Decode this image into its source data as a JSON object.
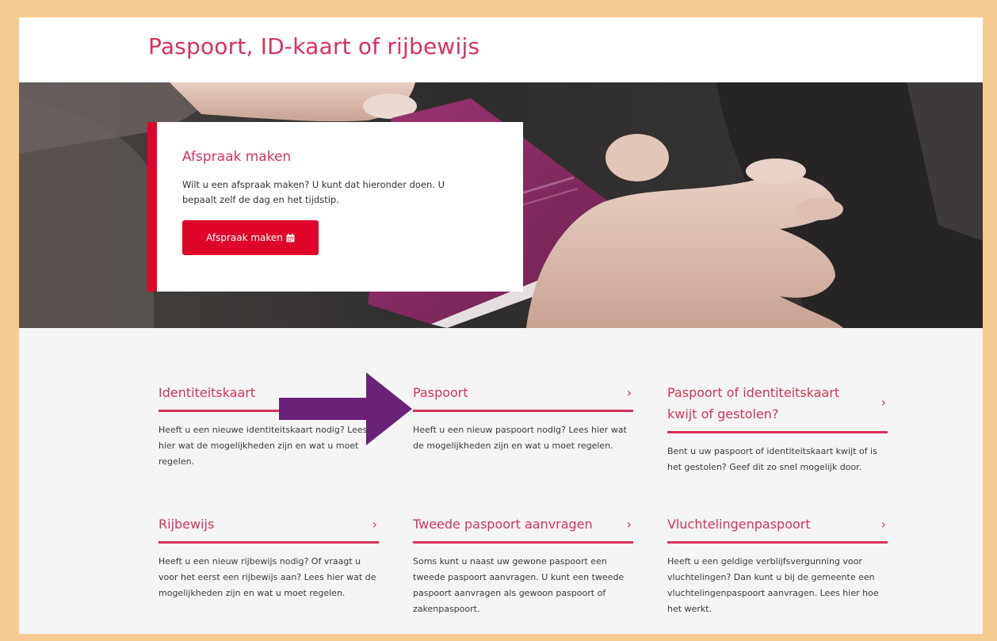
{
  "header": {
    "title": "Paspoort, ID-kaart of rijbewijs"
  },
  "appointment_card": {
    "title": "Afspraak maken",
    "text": "Wilt u een afspraak maken? U kunt dat hieronder doen. U bepaalt zelf de dag en het tijdstip.",
    "button_label": "Afspraak maken",
    "button_icon": "calendar-icon"
  },
  "tiles": [
    {
      "title": "Identiteitskaart",
      "text": "Heeft u een nieuwe identiteitskaart nodig? Lees hier wat de mogelijkheden zijn en wat u moet regelen."
    },
    {
      "title": "Paspoort",
      "text": "Heeft u een nieuw paspoort nodig? Lees hier wat de mogelijkheden zijn en wat u moet regelen."
    },
    {
      "title": "Paspoort of identiteitskaart kwijt of gestolen?",
      "text": "Bent u uw paspoort of identiteitskaart kwijt of is het gestolen? Geef dit zo snel mogelijk door."
    },
    {
      "title": "Rijbewijs",
      "text": "Heeft u een nieuw rijbewijs nodig? Of vraagt u voor het eerst een rijbewijs aan? Lees hier wat de mogelijkheden zijn en wat u moet regelen."
    },
    {
      "title": "Tweede paspoort aanvragen",
      "text": "Soms kunt u naast uw gewone paspoort een tweede paspoort aanvragen. U kunt een tweede paspoort aanvragen als gewoon paspoort of zakenpaspoort."
    },
    {
      "title": "Vluchtelingenpaspoort",
      "text": "Heeft u een geldige verblijfsvergunning voor vluchtelingen? Dan kunt u bij de gemeente een vluchtelingenpaspoort aanvragen. Lees hier hoe het werkt."
    }
  ],
  "chevron": "›",
  "colors": {
    "accent": "#d6335a",
    "button": "#e0062b",
    "frame": "#f6cb92",
    "arrow": "#6a2378",
    "passport": "#8c2a63"
  }
}
